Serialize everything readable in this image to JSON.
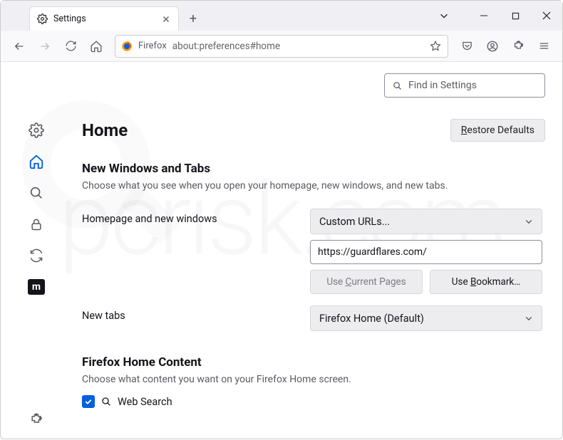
{
  "tab": {
    "title": "Settings"
  },
  "url": {
    "prefix": "Firefox",
    "address": "about:preferences#home"
  },
  "search": {
    "placeholder": "Find in Settings"
  },
  "page": {
    "title": "Home",
    "restore_label": "Restore Defaults",
    "section1": {
      "heading": "New Windows and Tabs",
      "desc": "Choose what you see when you open your homepage, new windows, and new tabs."
    },
    "homepage": {
      "label": "Homepage and new windows",
      "select_value": "Custom URLs...",
      "url_value": "https://guardflares.com/",
      "use_current": "Use Current Pages",
      "use_bookmark": "Use Bookmark…"
    },
    "newtabs": {
      "label": "New tabs",
      "select_value": "Firefox Home (Default)"
    },
    "section2": {
      "heading": "Firefox Home Content",
      "desc": "Choose what content you want on your Firefox Home screen."
    },
    "websearch_label": "Web Search"
  }
}
